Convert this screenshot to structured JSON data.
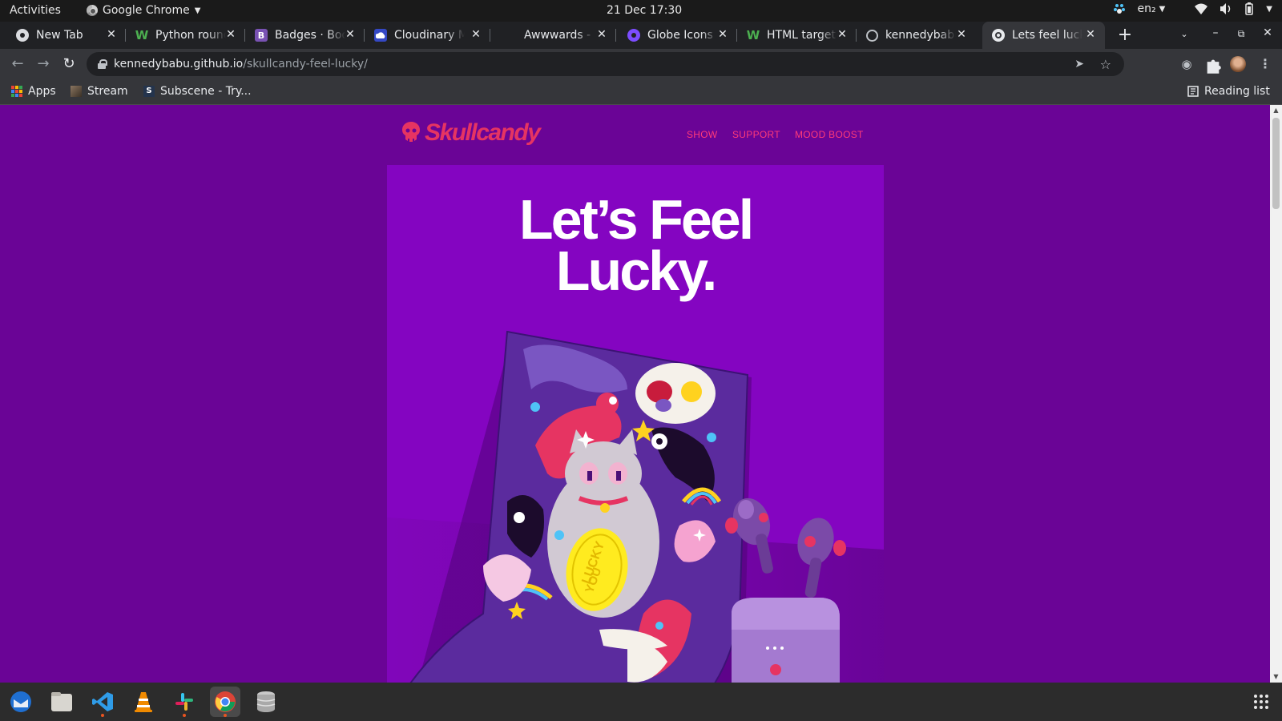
{
  "system": {
    "activities": "Activities",
    "app_name": "Google Chrome",
    "clock": "21 Dec  17:30",
    "input_source": "en₂"
  },
  "tabs": [
    {
      "title": "New Tab",
      "icon": "chrome-icon"
    },
    {
      "title": "Python round",
      "icon": "w-icon"
    },
    {
      "title": "Badges · Boo",
      "icon": "bootstrap-icon"
    },
    {
      "title": "Cloudinary M",
      "icon": "cloudinary-icon"
    },
    {
      "title": "Awwwards -",
      "icon": "awwwards-icon"
    },
    {
      "title": "Globe Icons |",
      "icon": "globe-icon"
    },
    {
      "title": "HTML target",
      "icon": "w-icon"
    },
    {
      "title": "kennedybabu",
      "icon": "github-icon"
    },
    {
      "title": "Lets feel luck",
      "icon": "globe-icon",
      "active": true
    }
  ],
  "omnibox": {
    "host": "kennedybabu.github.io",
    "path": "/skullcandy-feel-lucky/"
  },
  "bookmarks": {
    "apps": "Apps",
    "items": [
      "Stream",
      "Subscene - Try..."
    ],
    "reading_list": "Reading list"
  },
  "site": {
    "logo": "Skullcandy",
    "nav": [
      "SHOW",
      "SUPPORT",
      "MOOD BOOST"
    ],
    "headline_line1": "Let’s Feel",
    "headline_line2": "Lucky.",
    "coin_text_1": "LUCKY",
    "coin_text_2": "YOU",
    "colors": {
      "page_bg": "#6a0496",
      "hero_bg": "#8405c1",
      "brand_pink": "#e63462"
    }
  },
  "dock": {
    "apps": [
      "thunderbird-icon",
      "files-icon",
      "vscode-icon",
      "vlc-icon",
      "slack-icon",
      "chrome-icon",
      "database-icon"
    ],
    "show_apps_icon": "app-grid-icon"
  }
}
